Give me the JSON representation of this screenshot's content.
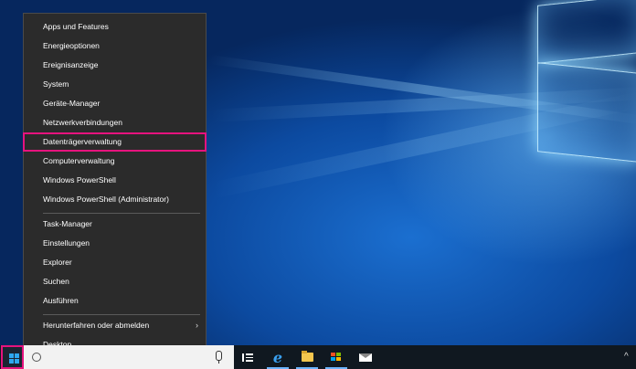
{
  "menu": {
    "group1": [
      {
        "label": "Apps und Features"
      },
      {
        "label": "Energieoptionen"
      },
      {
        "label": "Ereignisanzeige"
      },
      {
        "label": "System"
      },
      {
        "label": "Geräte-Manager"
      },
      {
        "label": "Netzwerkverbindungen"
      },
      {
        "label": "Datenträgerverwaltung",
        "highlighted": true
      },
      {
        "label": "Computerverwaltung"
      },
      {
        "label": "Windows PowerShell"
      },
      {
        "label": "Windows PowerShell (Administrator)"
      }
    ],
    "group2": [
      {
        "label": "Task-Manager"
      },
      {
        "label": "Einstellungen"
      },
      {
        "label": "Explorer"
      },
      {
        "label": "Suchen"
      },
      {
        "label": "Ausführen"
      }
    ],
    "group3": [
      {
        "label": "Herunterfahren oder abmelden",
        "submenu": true
      },
      {
        "label": "Desktop"
      }
    ],
    "submenu_glyph": "›"
  },
  "taskbar": {
    "start_icon": "windows-logo-icon",
    "icons": [
      "search-icon",
      "microphone-icon",
      "task-view-icon",
      "edge-icon",
      "file-explorer-icon",
      "store-icon",
      "mail-icon"
    ],
    "tray_arrow": "^",
    "edge_glyph": "e"
  },
  "colors": {
    "highlight_border": "#e6137e",
    "menu_background": "#2b2b2b",
    "taskbar_background": "#101820",
    "accent": "#2ea8f0"
  }
}
